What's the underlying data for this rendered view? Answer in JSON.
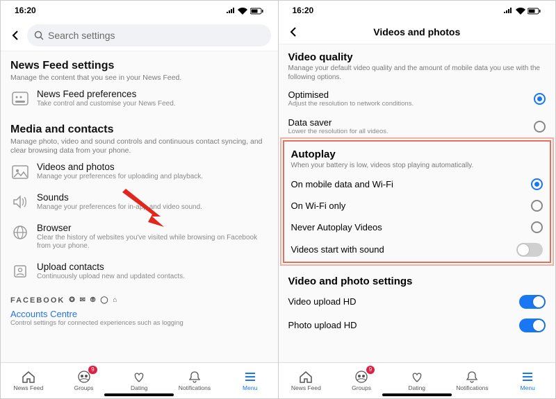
{
  "status": {
    "time": "16:20"
  },
  "left": {
    "search_placeholder": "Search settings",
    "newsfeed": {
      "title": "News Feed settings",
      "sub": "Manage the content that you see in your News Feed.",
      "pref": {
        "title": "News Feed preferences",
        "sub": "Take control and customise your News Feed."
      }
    },
    "media": {
      "title": "Media and contacts",
      "sub": "Manage photo, video and sound controls and continuous contact syncing, and clear browsing data from your phone.",
      "videos": {
        "title": "Videos and photos",
        "sub": "Manage your preferences for uploading and playback."
      },
      "sounds": {
        "title": "Sounds",
        "sub": "Manage your preferences for in-app and video sound."
      },
      "browser": {
        "title": "Browser",
        "sub": "Clear the history of websites you've visited while browsing on Facebook from your phone."
      },
      "upload": {
        "title": "Upload contacts",
        "sub": "Continuously upload new and updated contacts."
      }
    },
    "brand": "FACEBOOK",
    "accounts": {
      "title": "Accounts Centre",
      "sub": "Control settings for connected experiences such as logging"
    }
  },
  "right": {
    "header": "Videos and photos",
    "quality": {
      "title": "Video quality",
      "sub": "Manage your default video quality and the amount of mobile data you use with the following options.",
      "optimised": {
        "title": "Optimised",
        "sub": "Adjust the resolution to network conditions."
      },
      "saver": {
        "title": "Data saver",
        "sub": "Lower the resolution for all videos."
      }
    },
    "autoplay": {
      "title": "Autoplay",
      "sub": "When your battery is low, videos stop playing automatically.",
      "opt1": "On mobile data and Wi-Fi",
      "opt2": "On Wi-Fi only",
      "opt3": "Never Autoplay Videos",
      "sound": "Videos start with sound"
    },
    "vps": {
      "title": "Video and photo settings",
      "video_hd": "Video upload HD",
      "photo_hd": "Photo upload HD"
    }
  },
  "tabs": {
    "feed": "News Feed",
    "groups": "Groups",
    "dating": "Dating",
    "notif": "Notifications",
    "menu": "Menu",
    "badge": "9"
  }
}
